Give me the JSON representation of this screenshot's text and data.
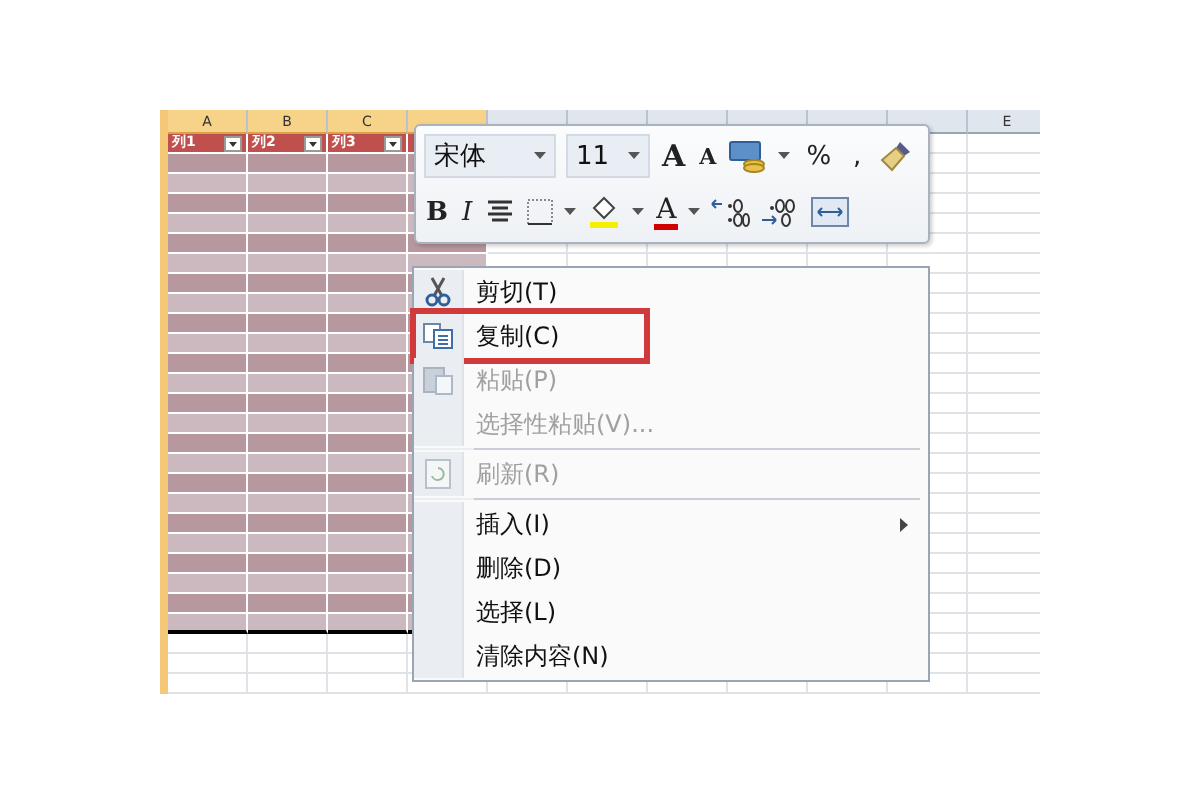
{
  "sheet": {
    "columns": [
      {
        "label": "A",
        "selected": true
      },
      {
        "label": "B",
        "selected": true
      },
      {
        "label": "C",
        "selected": true
      },
      {
        "label": "E",
        "selected": false
      }
    ],
    "header_cells": [
      "列1",
      "列2",
      "列3"
    ]
  },
  "mini_toolbar": {
    "font": "宋体",
    "size": "11",
    "row1": [
      {
        "kind": "grow",
        "label": "A"
      },
      {
        "kind": "shrink",
        "label": "A"
      },
      {
        "kind": "currency",
        "dropdown": true
      },
      {
        "kind": "text",
        "label": "%"
      },
      {
        "kind": "text",
        "label": ","
      },
      {
        "kind": "painter"
      }
    ],
    "row2": [
      {
        "kind": "bold",
        "label": "B"
      },
      {
        "kind": "italic",
        "label": "I"
      },
      {
        "kind": "align"
      },
      {
        "kind": "border",
        "dropdown": true
      },
      {
        "kind": "fill",
        "dropdown": true
      },
      {
        "kind": "fontcolor",
        "label": "A",
        "dropdown": true
      },
      {
        "kind": "inc-decimal"
      },
      {
        "kind": "dec-decimal"
      },
      {
        "kind": "merge"
      }
    ]
  },
  "context_menu": [
    {
      "kind": "cut",
      "label": "剪切(T)",
      "disabled": false,
      "highlighted": false
    },
    {
      "kind": "copy",
      "label": "复制(C)",
      "disabled": false,
      "highlighted": true
    },
    {
      "kind": "paste",
      "label": "粘贴(P)",
      "disabled": true,
      "highlighted": false
    },
    {
      "kind": "item",
      "label": "选择性粘贴(V)...",
      "disabled": true,
      "highlighted": false
    },
    {
      "kind": "separator"
    },
    {
      "kind": "refresh",
      "label": "刷新(R)",
      "disabled": true,
      "highlighted": false
    },
    {
      "kind": "separator"
    },
    {
      "kind": "item",
      "label": "插入(I)",
      "submenu": true,
      "disabled": false,
      "highlighted": false
    },
    {
      "kind": "item",
      "label": "删除(D)",
      "disabled": false,
      "highlighted": false
    },
    {
      "kind": "item",
      "label": "选择(L)",
      "disabled": false,
      "highlighted": false
    },
    {
      "kind": "item",
      "label": "清除内容(N)",
      "disabled": false,
      "highlighted": false
    }
  ]
}
